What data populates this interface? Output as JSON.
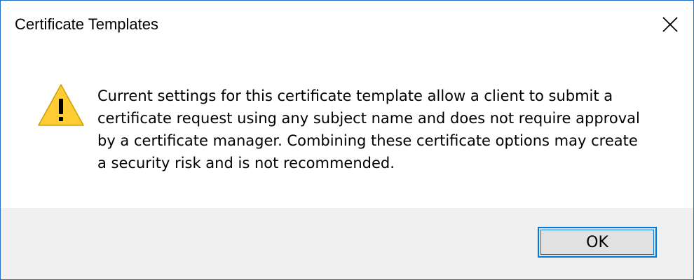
{
  "window": {
    "title": "Certificate Templates",
    "close_icon": "close-icon"
  },
  "message": {
    "icon": "warning-icon",
    "text": "Current settings for this certificate template allow a client to submit a certificate request using any subject name and does not require approval by a certificate manager. Combining these certificate options may create a security risk and is not recommended."
  },
  "buttons": {
    "ok_label": "OK"
  },
  "colors": {
    "border": "#1f6fc5",
    "footer_bg": "#f0f0f0",
    "button_bg": "#e1e1e1",
    "button_focus": "#0078d7",
    "warning_fill": "#ffcc33"
  }
}
